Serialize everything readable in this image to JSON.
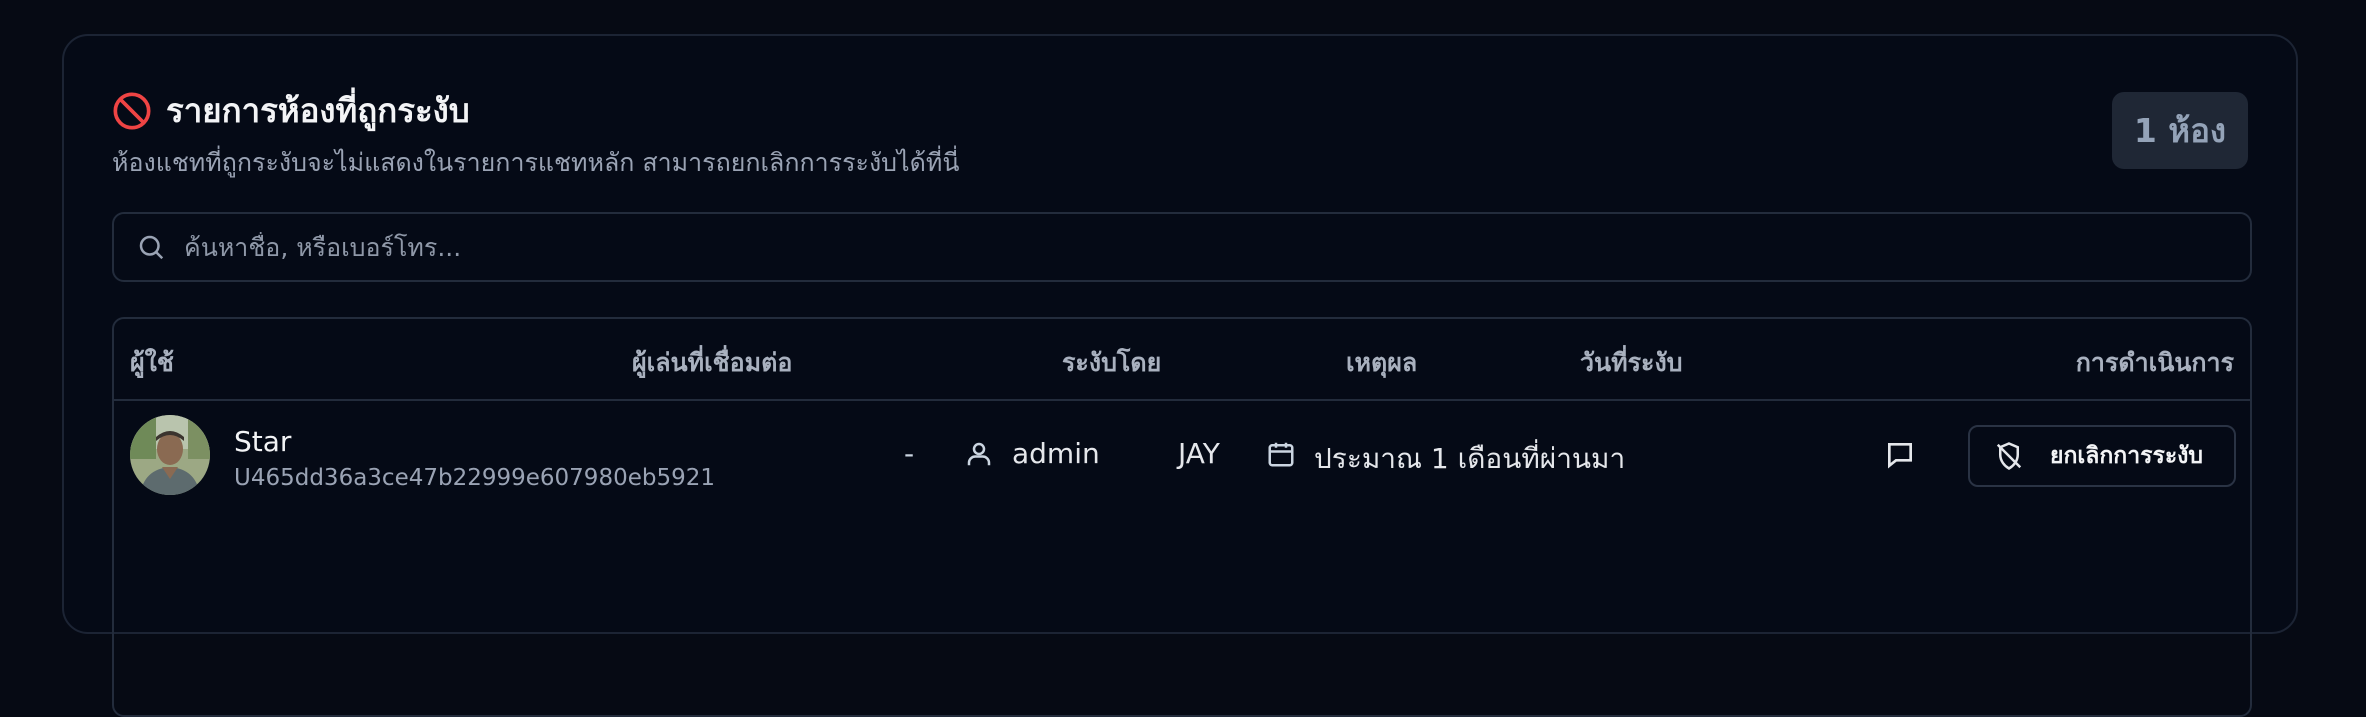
{
  "header": {
    "title": "รายการห้องที่ถูกระงับ",
    "subtitle": "ห้องแชทที่ถูกระงับจะไม่แสดงในรายการแชทหลัก สามารถยกเลิกการระงับได้ที่นี่",
    "count_badge": "1 ห้อง"
  },
  "search": {
    "placeholder": "ค้นหาชื่อ, หรือเบอร์โทร..."
  },
  "table": {
    "columns": [
      "ผู้ใช้",
      "ผู้เล่นที่เชื่อมต่อ",
      "ระงับโดย",
      "เหตุผล",
      "วันที่ระงับ",
      "การดำเนินการ"
    ],
    "rows": [
      {
        "name": "Star",
        "user_id": "U465dd36a3ce47b22999e607980eb5921",
        "linked_player": "-",
        "blocked_by": "admin",
        "reason": "JAY",
        "blocked_date": "ประมาณ 1 เดือนที่ผ่านมา",
        "unblock_label": "ยกเลิกการระงับ"
      }
    ]
  },
  "colors": {
    "background": "#060a14",
    "card": "#050a16",
    "border": "#232c3c",
    "ban_icon": "#ef4444",
    "badge_bg": "#1f2735"
  },
  "icons": [
    "ban-icon",
    "search-icon",
    "user-icon",
    "calendar-icon",
    "message-icon",
    "shield-off-icon"
  ]
}
